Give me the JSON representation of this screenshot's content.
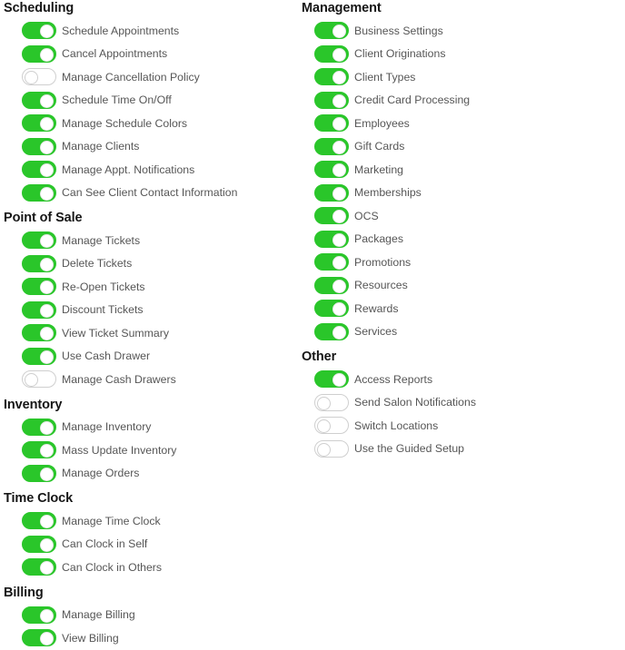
{
  "theme": {
    "toggle_on_color": "#2ac62a",
    "toggle_off_border": "#cfcfcf",
    "label_color": "#565656",
    "header_color": "#161616",
    "background": "#ffffff"
  },
  "columns": [
    {
      "name": "left",
      "sections": [
        {
          "title": "Scheduling",
          "items": [
            {
              "label": "Schedule Appointments",
              "state": "on"
            },
            {
              "label": "Cancel Appointments",
              "state": "on"
            },
            {
              "label": "Manage Cancellation Policy",
              "state": "off"
            },
            {
              "label": "Schedule Time On/Off",
              "state": "on"
            },
            {
              "label": "Manage Schedule Colors",
              "state": "on"
            },
            {
              "label": "Manage Clients",
              "state": "on"
            },
            {
              "label": "Manage Appt. Notifications",
              "state": "on"
            },
            {
              "label": "Can See Client Contact Information",
              "state": "on"
            }
          ]
        },
        {
          "title": "Point of Sale",
          "items": [
            {
              "label": "Manage Tickets",
              "state": "on"
            },
            {
              "label": "Delete Tickets",
              "state": "on"
            },
            {
              "label": "Re-Open Tickets",
              "state": "on"
            },
            {
              "label": "Discount Tickets",
              "state": "on"
            },
            {
              "label": "View Ticket Summary",
              "state": "on"
            },
            {
              "label": "Use Cash Drawer",
              "state": "on"
            },
            {
              "label": "Manage Cash Drawers",
              "state": "off"
            }
          ]
        },
        {
          "title": "Inventory",
          "items": [
            {
              "label": "Manage Inventory",
              "state": "on"
            },
            {
              "label": "Mass Update Inventory",
              "state": "on"
            },
            {
              "label": "Manage Orders",
              "state": "on"
            }
          ]
        },
        {
          "title": "Time Clock",
          "items": [
            {
              "label": "Manage Time Clock",
              "state": "on"
            },
            {
              "label": "Can Clock in Self",
              "state": "on"
            },
            {
              "label": "Can Clock in Others",
              "state": "on"
            }
          ]
        },
        {
          "title": "Billing",
          "items": [
            {
              "label": "Manage Billing",
              "state": "on"
            },
            {
              "label": "View Billing",
              "state": "on"
            }
          ]
        }
      ]
    },
    {
      "name": "right",
      "sections": [
        {
          "title": "Management",
          "items": [
            {
              "label": "Business Settings",
              "state": "on"
            },
            {
              "label": "Client Originations",
              "state": "on"
            },
            {
              "label": "Client Types",
              "state": "on"
            },
            {
              "label": "Credit Card Processing",
              "state": "on"
            },
            {
              "label": "Employees",
              "state": "on"
            },
            {
              "label": "Gift Cards",
              "state": "on"
            },
            {
              "label": "Marketing",
              "state": "on"
            },
            {
              "label": "Memberships",
              "state": "on"
            },
            {
              "label": "OCS",
              "state": "on"
            },
            {
              "label": "Packages",
              "state": "on"
            },
            {
              "label": "Promotions",
              "state": "on"
            },
            {
              "label": "Resources",
              "state": "on"
            },
            {
              "label": "Rewards",
              "state": "on"
            },
            {
              "label": "Services",
              "state": "on"
            }
          ]
        },
        {
          "title": "Other",
          "items": [
            {
              "label": "Access Reports",
              "state": "on"
            },
            {
              "label": "Send Salon Notifications",
              "state": "off"
            },
            {
              "label": "Switch Locations",
              "state": "off"
            },
            {
              "label": "Use the Guided Setup",
              "state": "off"
            }
          ]
        }
      ]
    }
  ]
}
